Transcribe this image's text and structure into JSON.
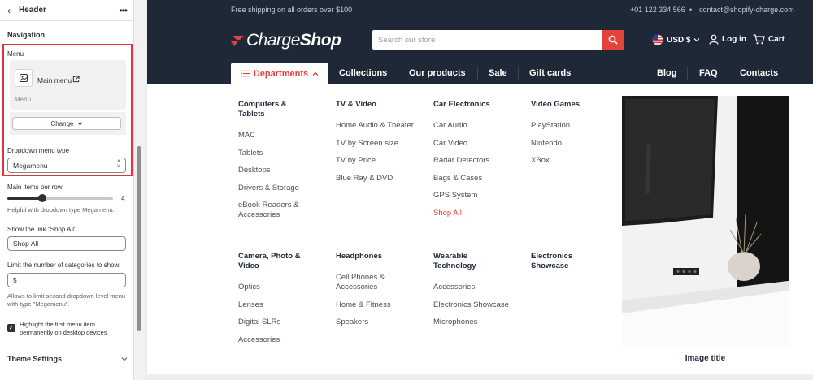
{
  "editor": {
    "header_title": "Header",
    "section_title": "Navigation",
    "menu_label": "Menu",
    "menu_name": "Main menu",
    "menu_sub": "Menu",
    "change_label": "Change",
    "dropdown_type_label": "Dropdown menu type",
    "dropdown_type_value": "Megamenu",
    "items_per_row_label": "Main items per row",
    "items_per_row_value": "4",
    "items_per_row_fraction": 0.33,
    "items_per_row_help": "Helpful with dropdown type Megamenu.",
    "shop_all_label": "Show the link \"Shop All\"",
    "shop_all_value": "Shop All",
    "limit_label": "Limit the number of categories to show.",
    "limit_value": "5",
    "limit_help": "Allows to limit second dropdown level menu with type \"Megamenu\".",
    "highlight_label": "Highlight the first menu item permanently on desktop devices",
    "highlight_checked": true,
    "theme_settings": "Theme Settings",
    "highlight_color": "#e1333f"
  },
  "store": {
    "topbar": {
      "shipping": "Free shipping on all orders over $100",
      "phone": "+01 122 334 566",
      "email": "contact@shopify-charge.com"
    },
    "logo": {
      "part1": "Charge",
      "part2": "Shop"
    },
    "search_placeholder": "Search our store",
    "currency": "USD $",
    "login": "Log in",
    "cart": "Cart",
    "nav": {
      "departments": "Departments",
      "items": [
        "Collections",
        "Our products",
        "Sale",
        "Gift cards"
      ],
      "right_items": [
        "Blog",
        "FAQ",
        "Contacts"
      ]
    },
    "megamenu": {
      "columns_row1": [
        {
          "title": "Computers & Tablets",
          "links": [
            "MAC",
            "Tablets",
            "Desktops",
            "Drivers & Storage",
            "eBook Readers & Accessories"
          ]
        },
        {
          "title": "TV & Video",
          "links": [
            "Home Audio & Theater",
            "TV by Screen size",
            "TV by Price",
            "Blue Ray & DVD"
          ]
        },
        {
          "title": "Car Electronics",
          "links": [
            "Car Audio",
            "Car Video",
            "Radar Detectors",
            "Bags & Cases",
            "GPS System",
            "Shop All"
          ]
        },
        {
          "title": "Video Games",
          "links": [
            "PlayStation",
            "Nintendo",
            "XBox"
          ]
        }
      ],
      "columns_row2": [
        {
          "title": "Camera, Photo & Video",
          "links": [
            "Optics",
            "Lenses",
            "Digital SLRs",
            "Accessories"
          ]
        },
        {
          "title": "Headphones",
          "links": [
            "Cell Phones & Accessories",
            "Home & Fitness",
            "Speakers"
          ]
        },
        {
          "title": "Wearable Technology",
          "links": [
            "Accessories",
            "Electronics Showcase",
            "Microphones"
          ]
        },
        {
          "title": "Electronics Showcase",
          "links": []
        }
      ],
      "image_title": "Image title"
    },
    "colors": {
      "dark": "#1f2837",
      "accent": "#e2433a"
    }
  }
}
